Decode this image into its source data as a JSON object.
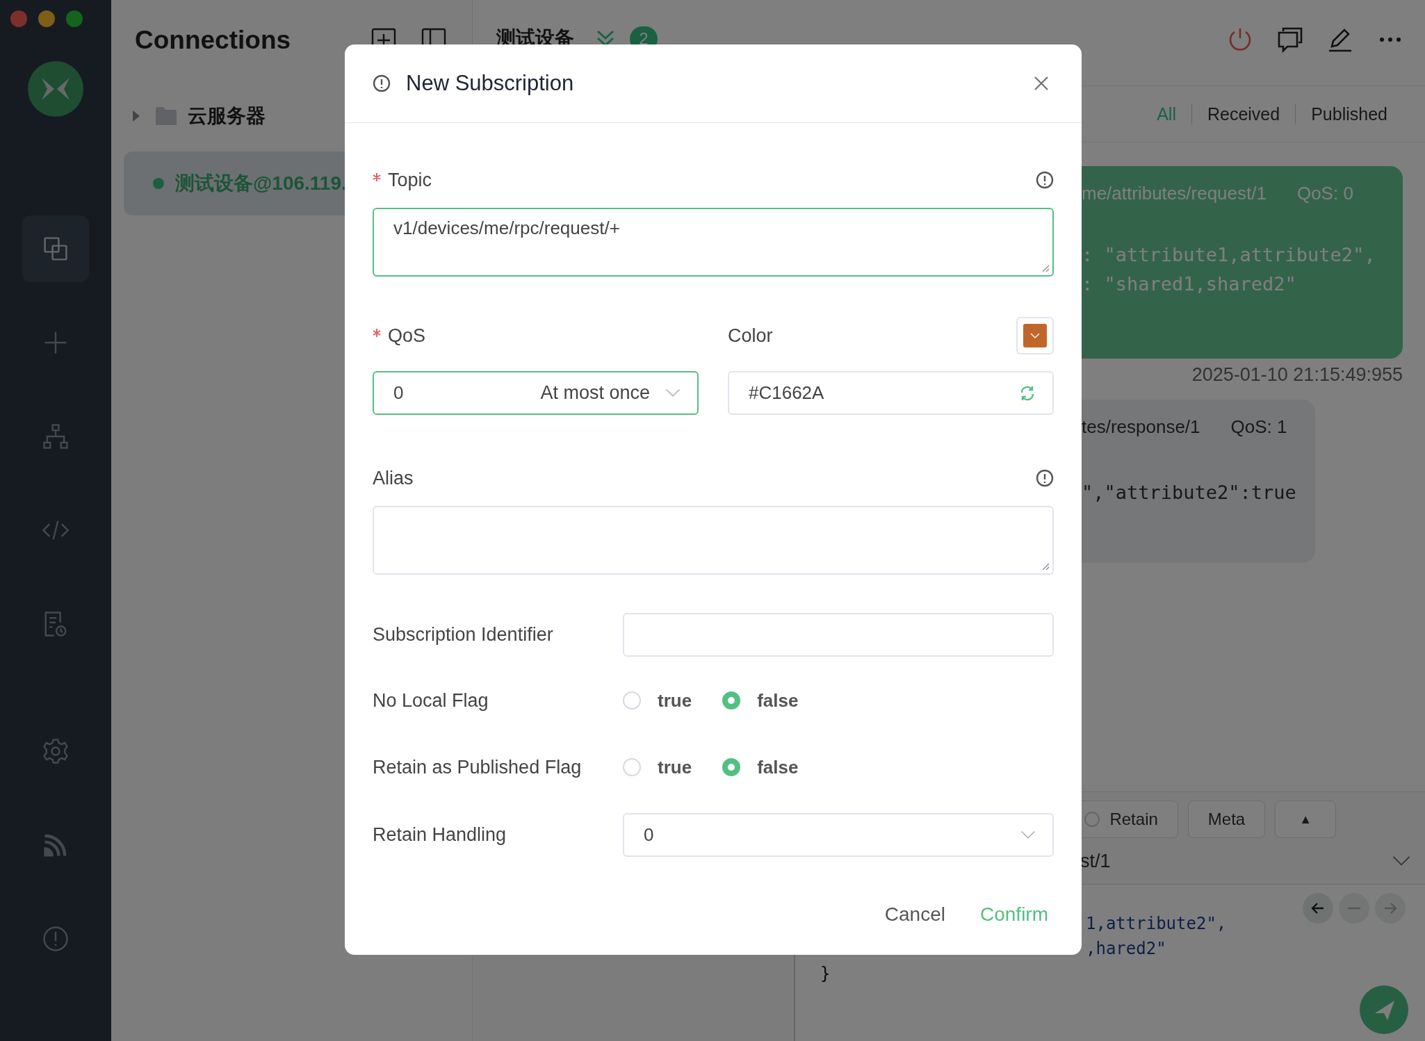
{
  "sidebar": {
    "items": [
      {
        "kind": "connections",
        "selected": true
      },
      {
        "kind": "new",
        "selected": false
      },
      {
        "kind": "topology",
        "selected": false
      },
      {
        "kind": "script",
        "selected": false
      },
      {
        "kind": "log",
        "selected": false
      },
      {
        "kind": "settings",
        "selected": false
      },
      {
        "kind": "feed",
        "selected": false
      },
      {
        "kind": "about",
        "selected": false
      }
    ]
  },
  "connections_panel": {
    "title": "Connections",
    "groups": [
      {
        "name": "云服务器",
        "expanded": false
      }
    ],
    "connections": [
      {
        "name": "测试设备@106.119.",
        "selected": true,
        "online": true
      }
    ]
  },
  "main": {
    "title": "测试设备",
    "badge": "2",
    "filters": [
      {
        "label": "All",
        "selected": true
      },
      {
        "label": "Received",
        "selected": false
      },
      {
        "label": "Published",
        "selected": false
      }
    ],
    "messages": [
      {
        "kind": "published",
        "topic": "me/attributes/request/1",
        "qos": "QoS: 0",
        "lines": [
          ": \"attribute1,attribute2\",",
          ": \"shared1,shared2\""
        ],
        "time": "2025-01-10 21:15:49:955"
      },
      {
        "kind": "received",
        "topic": "tes/response/1",
        "qos": "QoS: 1",
        "lines": [
          "\",\"attribute2\":true"
        ]
      }
    ],
    "composer": {
      "retain": {
        "label": "Retain",
        "checked": false
      },
      "meta": "Meta",
      "toggle": "▲",
      "topic": "st/1",
      "code_lines": [
        {
          "text": "1,attribute2\",",
          "kind": "cut"
        },
        {
          "text": ",hared2\"",
          "kind": "cut"
        },
        {
          "text": "}",
          "kind": "full"
        }
      ]
    }
  },
  "dialog": {
    "title": "New Subscription",
    "topic": {
      "label": "Topic",
      "required": true,
      "value": "v1/devices/me/rpc/request/+"
    },
    "qos": {
      "label": "QoS",
      "required": true,
      "value": "0",
      "description": "At most once"
    },
    "color": {
      "label": "Color",
      "value": "#C1662A",
      "color": "#c1662a"
    },
    "alias": {
      "label": "Alias"
    },
    "subscription_identifier": {
      "label": "Subscription Identifier"
    },
    "flags": [
      {
        "label": "No Local Flag",
        "options": [
          {
            "label": "true",
            "selected": false
          },
          {
            "label": "false",
            "selected": true
          }
        ]
      },
      {
        "label": "Retain as Published Flag",
        "options": [
          {
            "label": "true",
            "selected": false
          },
          {
            "label": "false",
            "selected": true
          }
        ]
      }
    ],
    "retain_handling": {
      "label": "Retain Handling",
      "value": "0"
    },
    "buttons": [
      {
        "label": "Cancel",
        "kind": "secondary"
      },
      {
        "label": "Confirm",
        "kind": "primary"
      }
    ]
  }
}
